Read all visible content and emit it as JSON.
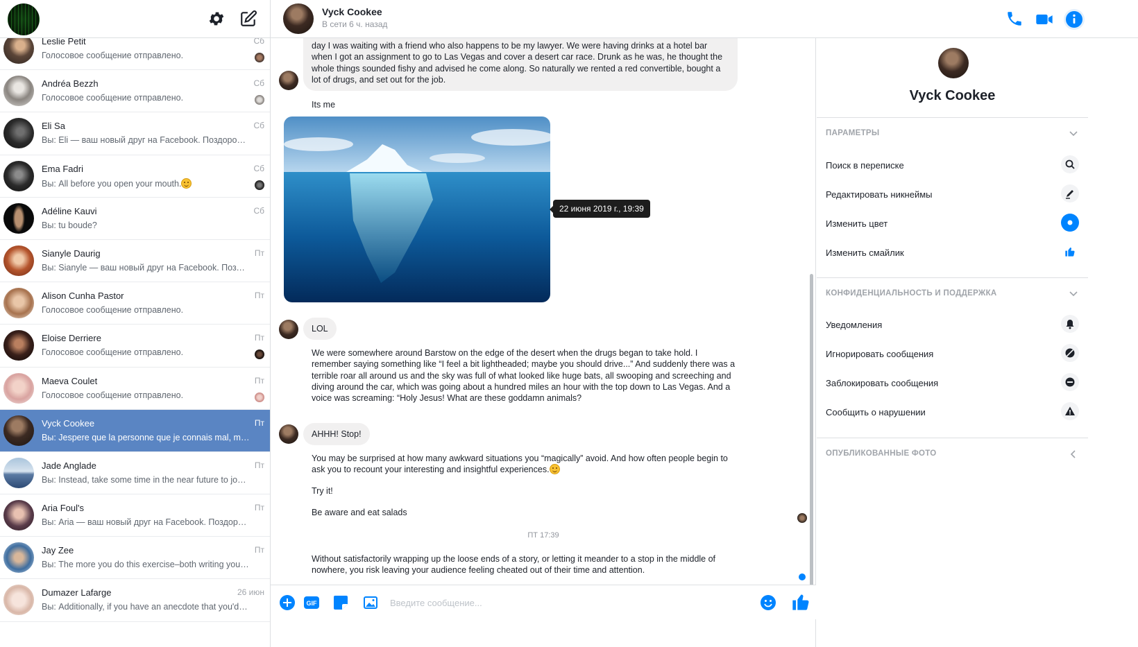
{
  "sidebar": {
    "conversations": [
      {
        "name": "Leslie Petit",
        "snippet": "Голосовое сообщение отправлено.",
        "time": "Сб"
      },
      {
        "name": "Andréa Bezzh",
        "snippet": "Голосовое сообщение отправлено.",
        "time": "Сб"
      },
      {
        "name": "Eli Sa",
        "snippet": "Вы: Eli — ваш новый друг на Facebook. Поздоровай...",
        "time": "Сб"
      },
      {
        "name": "Ema Fadri",
        "snippet": "Вы: All before you open your mouth.",
        "time": "Сб"
      },
      {
        "name": "Adéline Kauvi",
        "snippet": "Вы: tu boude?",
        "time": "Сб"
      },
      {
        "name": "Sianyle Daurig",
        "snippet": "Вы: Sianyle — ваш новый друг на Facebook. Поздор...",
        "time": "Пт"
      },
      {
        "name": "Alison Cunha Pastor",
        "snippet": "Голосовое сообщение отправлено.",
        "time": "Пт"
      },
      {
        "name": "Eloise Derriere",
        "snippet": "Голосовое сообщение отправлено.",
        "time": "Пт"
      },
      {
        "name": "Maeva Coulet",
        "snippet": "Голосовое сообщение отправлено.",
        "time": "Пт"
      },
      {
        "name": "Vyck Cookee",
        "snippet": "Вы: Jespere que la personne que je connais mal, mais...",
        "time": "Пт"
      },
      {
        "name": "Jade Anglade",
        "snippet": "Вы: Instead, take some time in the near future to journ...",
        "time": "Пт"
      },
      {
        "name": "Aria Foul's",
        "snippet": "Вы: Aria — ваш новый друг на Facebook. Поздоров...",
        "time": "Пт"
      },
      {
        "name": "Jay Zee",
        "snippet": "Вы: The more you do this exercise–both writing your a...",
        "time": "Пт"
      },
      {
        "name": "Dumazer Lafarge",
        "snippet": "Вы: Additionally, if you have an anecdote that you'd lik...",
        "time": "26 июн"
      }
    ]
  },
  "chat": {
    "name": "Vyck Cookee",
    "status": "В сети 6 ч. назад",
    "messages": {
      "top_bubble": "day I was waiting with a friend who also happens to be my lawyer. We were having drinks at a hotel bar when I got an assignment to go to Las Vegas and cover a desert car race. Drunk as he was, he thought the whole things sounded fishy and advised he come along. So naturally we rented a red convertible, bought a lot of drugs, and set out for the job.",
      "its_me": "Its  me",
      "photo_tooltip": "22 июня 2019 г., 19:39",
      "lol": "LOL",
      "barstow": "We were somewhere around Barstow on the edge of the desert when the drugs began to take hold. I remember saying something like “I feel a bit lightheaded; maybe you should drive...” And suddenly there was a terrible roar all around us and the sky was full of what looked like huge bats, all swooping and screeching and diving around the car, which was going about a hundred miles an hour with the top down to Las Vegas. And a voice was screaming: “Holy Jesus! What are these goddamn animals?",
      "ahhh": "AHHH! Stop!",
      "surprised": "You may be surprised at how many awkward situations you “magically” avoid. And how often people begin to ask you to recount your interesting and insightful experiences.",
      "try_it": "Try it!",
      "salads": "Be aware and eat salads",
      "timestamp": "ПТ 17:39",
      "last": "Without satisfactorily wrapping up the loose ends of a story, or letting it meander to a stop in the middle of nowhere, you risk leaving your audience feeling cheated out of their time and attention."
    },
    "composer_placeholder": "Введите сообщение..."
  },
  "info_panel": {
    "name": "Vyck Cookee",
    "params_title": "ПАРАМЕТРЫ",
    "params": [
      {
        "label": "Поиск в переписке",
        "icon": "search-icon"
      },
      {
        "label": "Редактировать никнеймы",
        "icon": "pencil-icon"
      },
      {
        "label": "Изменить цвет",
        "icon": "color-dot-icon"
      },
      {
        "label": "Изменить смайлик",
        "icon": "thumbs-up-icon"
      }
    ],
    "privacy_title": "КОНФИДЕНЦИАЛЬНОСТЬ И ПОДДЕРЖКА",
    "privacy": [
      {
        "label": "Уведомления",
        "icon": "bell-icon"
      },
      {
        "label": "Игнорировать сообщения",
        "icon": "mute-icon"
      },
      {
        "label": "Заблокировать сообщения",
        "icon": "block-icon"
      },
      {
        "label": "Сообщить о нарушении",
        "icon": "warning-icon"
      }
    ],
    "photos_title": "ОПУБЛИКОВАННЫЕ ФОТО"
  },
  "colors": {
    "accent": "#0084ff",
    "active_row": "#5a85c3"
  }
}
